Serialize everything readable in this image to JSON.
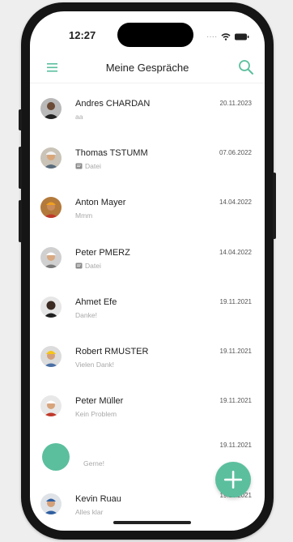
{
  "status_bar": {
    "time": "12:27",
    "dots": "····"
  },
  "appbar": {
    "title": "Meine Gespräche",
    "menu_icon": "menu-icon",
    "search_icon": "search-icon"
  },
  "colors": {
    "accent": "#5bbf9e",
    "text": "#222222",
    "muted": "#a8a8a8"
  },
  "conversations": [
    {
      "name": "Andres CHARDAN",
      "preview": "aa",
      "date": "20.11.2023",
      "attachment_icon": false
    },
    {
      "name": "Thomas TSTUMM",
      "preview": "Datei",
      "date": "07.06.2022",
      "attachment_icon": true
    },
    {
      "name": "Anton Mayer",
      "preview": "Mmm",
      "date": "14.04.2022",
      "attachment_icon": false
    },
    {
      "name": "Peter PMERZ",
      "preview": "Datei",
      "date": "14.04.2022",
      "attachment_icon": true
    },
    {
      "name": "Ahmet Efe",
      "preview": "Danke!",
      "date": "19.11.2021",
      "attachment_icon": false
    },
    {
      "name": "Robert RMUSTER",
      "preview": "Vielen Dank!",
      "date": "19.11.2021",
      "attachment_icon": false
    },
    {
      "name": "Peter Müller",
      "preview": "Kein Problem",
      "date": "19.11.2021",
      "attachment_icon": false
    },
    {
      "name": "",
      "preview": "Gerne!",
      "date": "19.11.2021",
      "attachment_icon": false
    },
    {
      "name": "Kevin Ruau",
      "preview": "Alles klar",
      "date": "19.11.2021",
      "attachment_icon": false
    }
  ],
  "fab": {
    "icon": "plus-icon"
  }
}
